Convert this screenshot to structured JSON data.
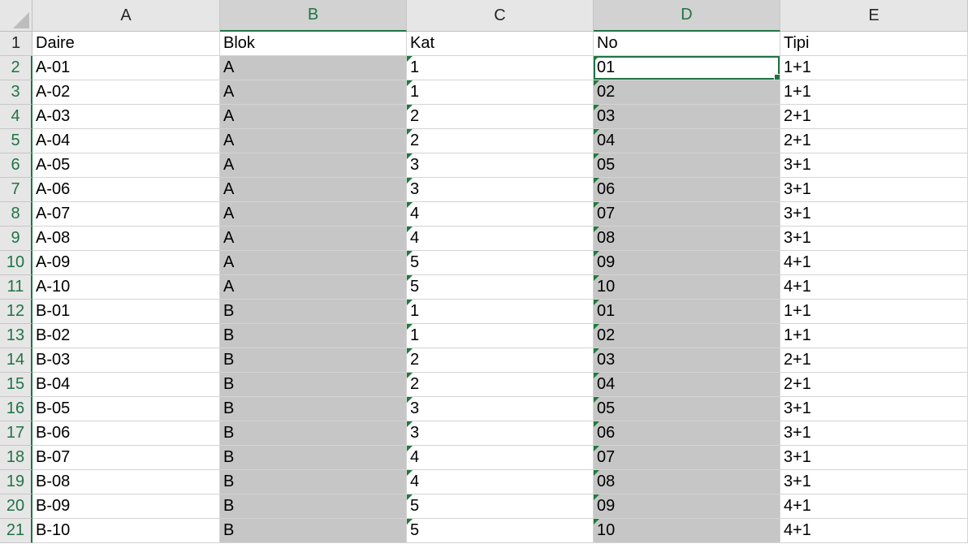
{
  "columns": [
    "A",
    "B",
    "C",
    "D",
    "E"
  ],
  "rows": [
    {
      "num": "1",
      "cells": [
        "Daire",
        "Blok",
        "Kat",
        "No",
        "Tipi"
      ]
    },
    {
      "num": "2",
      "cells": [
        "A-01",
        "A",
        "1",
        "01",
        "1+1"
      ]
    },
    {
      "num": "3",
      "cells": [
        "A-02",
        "A",
        "1",
        "02",
        "1+1"
      ]
    },
    {
      "num": "4",
      "cells": [
        "A-03",
        "A",
        "2",
        "03",
        "2+1"
      ]
    },
    {
      "num": "5",
      "cells": [
        "A-04",
        "A",
        "2",
        "04",
        "2+1"
      ]
    },
    {
      "num": "6",
      "cells": [
        "A-05",
        "A",
        "3",
        "05",
        "3+1"
      ]
    },
    {
      "num": "7",
      "cells": [
        "A-06",
        "A",
        "3",
        "06",
        "3+1"
      ]
    },
    {
      "num": "8",
      "cells": [
        "A-07",
        "A",
        "4",
        "07",
        "3+1"
      ]
    },
    {
      "num": "9",
      "cells": [
        "A-08",
        "A",
        "4",
        "08",
        "3+1"
      ]
    },
    {
      "num": "10",
      "cells": [
        "A-09",
        "A",
        "5",
        "09",
        "4+1"
      ]
    },
    {
      "num": "11",
      "cells": [
        "A-10",
        "A",
        "5",
        "10",
        "4+1"
      ]
    },
    {
      "num": "12",
      "cells": [
        "B-01",
        "B",
        "1",
        "01",
        "1+1"
      ]
    },
    {
      "num": "13",
      "cells": [
        "B-02",
        "B",
        "1",
        "02",
        "1+1"
      ]
    },
    {
      "num": "14",
      "cells": [
        "B-03",
        "B",
        "2",
        "03",
        "2+1"
      ]
    },
    {
      "num": "15",
      "cells": [
        "B-04",
        "B",
        "2",
        "04",
        "2+1"
      ]
    },
    {
      "num": "16",
      "cells": [
        "B-05",
        "B",
        "3",
        "05",
        "3+1"
      ]
    },
    {
      "num": "17",
      "cells": [
        "B-06",
        "B",
        "3",
        "06",
        "3+1"
      ]
    },
    {
      "num": "18",
      "cells": [
        "B-07",
        "B",
        "4",
        "07",
        "3+1"
      ]
    },
    {
      "num": "19",
      "cells": [
        "B-08",
        "B",
        "4",
        "08",
        "3+1"
      ]
    },
    {
      "num": "20",
      "cells": [
        "B-09",
        "B",
        "5",
        "09",
        "4+1"
      ]
    },
    {
      "num": "21",
      "cells": [
        "B-10",
        "B",
        "5",
        "10",
        "4+1"
      ]
    }
  ],
  "selected_columns": [
    "B",
    "D"
  ],
  "active_cell": "D2",
  "colors": {
    "accent": "#217346",
    "selection_shade": "#c6c6c6",
    "header_bg": "#e6e6e6",
    "error_flag": "#1f7a3a"
  }
}
